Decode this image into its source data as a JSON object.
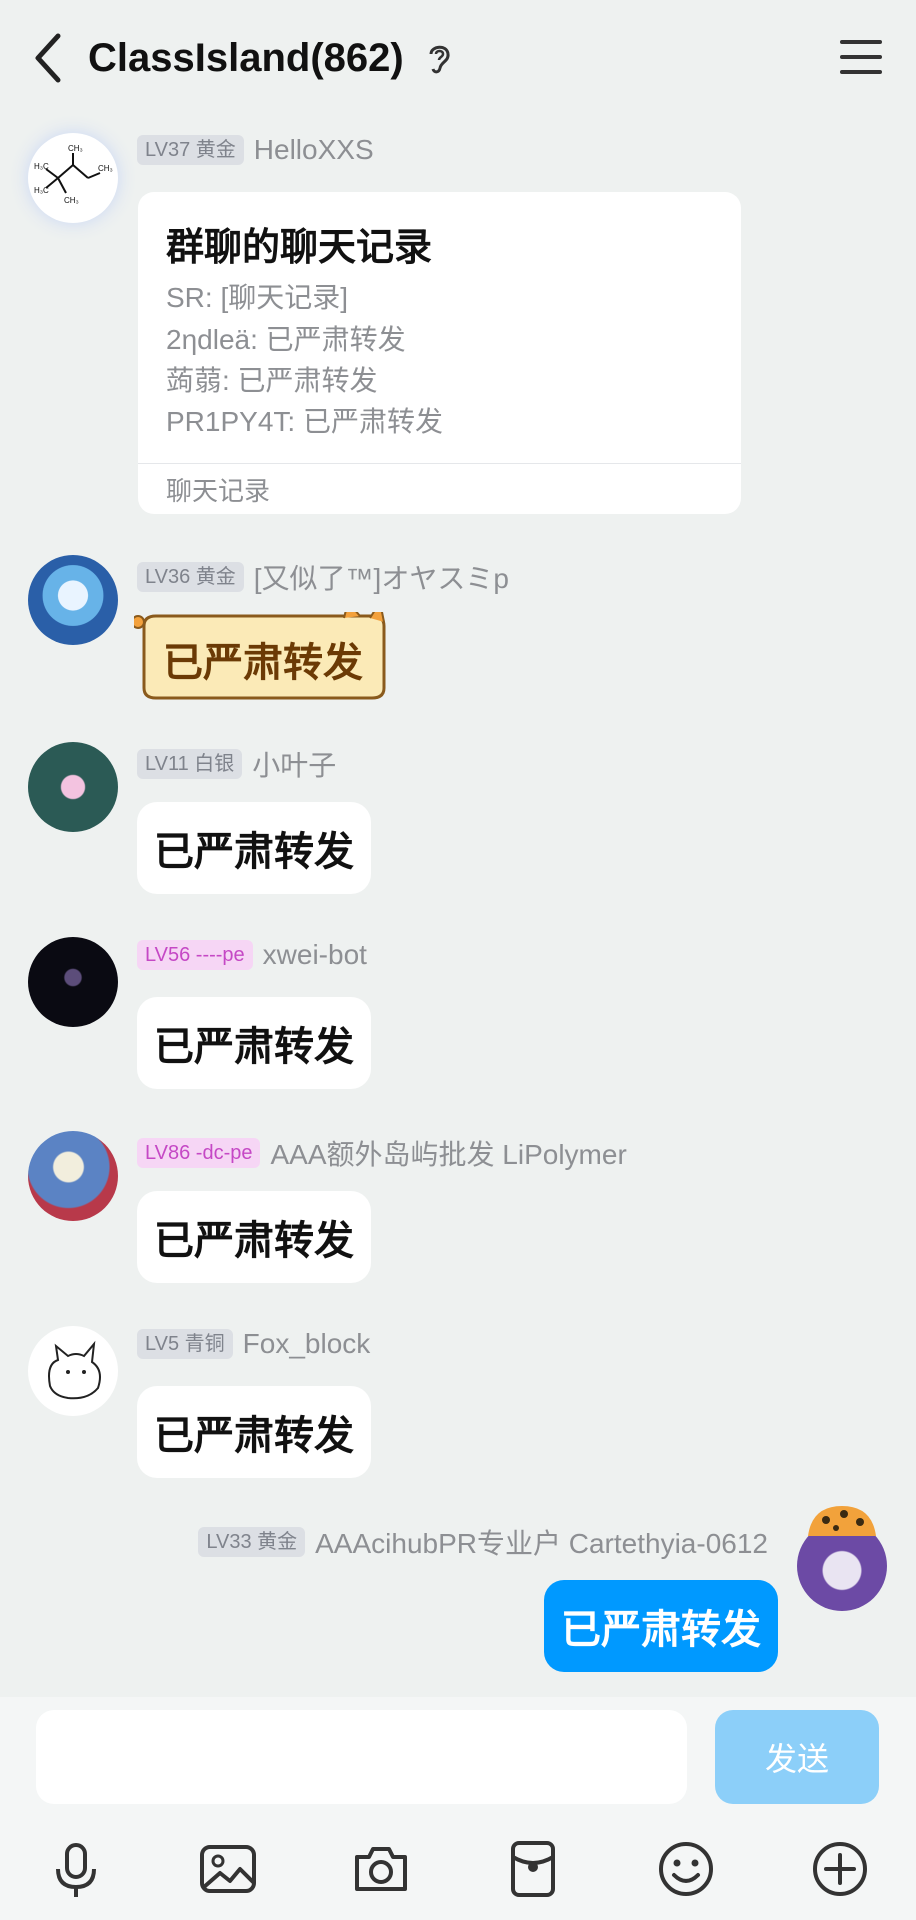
{
  "header": {
    "title": "ClassIsland(862)"
  },
  "card_message": {
    "level": "LV37 黄金",
    "username": "HelloXXS",
    "card": {
      "title": "群聊的聊天记录",
      "lines": [
        "SR: [聊天记录]",
        "2ηdleä: 已严肃转发",
        "蒟蒻: 已严肃转发",
        "PR1PY4T: 已严肃转发"
      ],
      "footer": "聊天记录"
    }
  },
  "messages": [
    {
      "level": "LV36 黄金",
      "username": "[又似了™]オヤスミp",
      "text": "已严肃转发"
    },
    {
      "level": "LV11 白银",
      "username": "小叶子",
      "text": "已严肃转发"
    },
    {
      "level": "LV56 ----pe",
      "username": "xwei-bot",
      "text": "已严肃转发"
    },
    {
      "level": "LV86 -dc-pe",
      "username": "AAA额外岛屿批发 LiPolymer",
      "text": "已严肃转发"
    },
    {
      "level": "LV5 青铜",
      "username": "Fox_block",
      "text": "已严肃转发"
    }
  ],
  "own_message": {
    "level": "LV33 黄金",
    "username": "AAAcihubPR专业户 Cartethyia-0612",
    "text": "已严肃转发"
  },
  "composer": {
    "send_label": "发送"
  },
  "colors": {
    "accent": "#0099ff",
    "send_disabled": "#8ccff9",
    "background": "#eef1f0"
  },
  "icons": [
    "back-icon",
    "ear-icon",
    "menu-icon",
    "mic-icon",
    "image-icon",
    "camera-icon",
    "red-packet-icon",
    "emoji-icon",
    "plus-icon"
  ]
}
